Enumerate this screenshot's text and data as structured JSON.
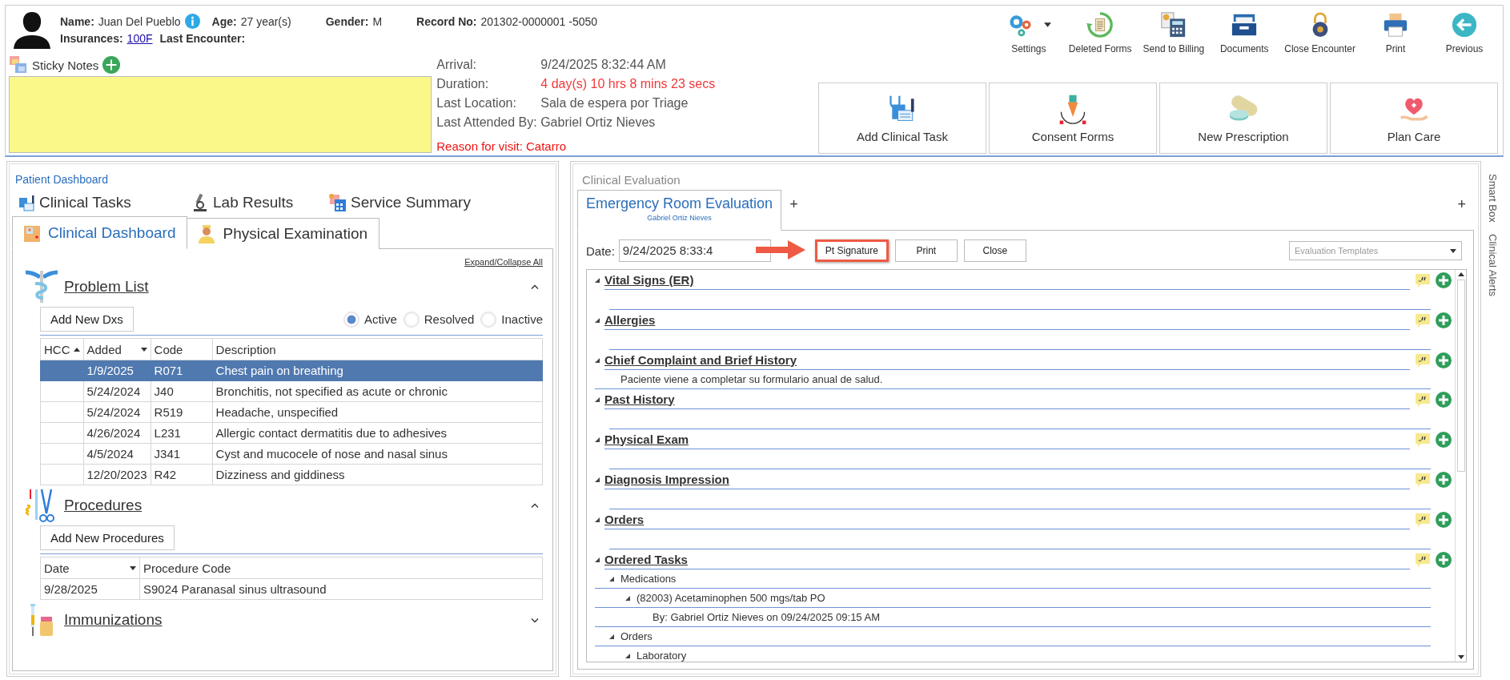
{
  "patient": {
    "name_label": "Name:",
    "name": "Juan Del Pueblo",
    "age_label": "Age:",
    "age": "27 year(s)",
    "gender_label": "Gender:",
    "gender": "M",
    "record_label": "Record No:",
    "record": "201302-0000001 -5050",
    "insurances_label": "Insurances:",
    "insurance": "100F",
    "last_encounter_label": "Last Encounter:"
  },
  "toolbar": [
    {
      "label": "Settings",
      "kind": "settings"
    },
    {
      "label": "Deleted Forms",
      "kind": "deleted"
    },
    {
      "label": "Send to Billing",
      "kind": "billing"
    },
    {
      "label": "Documents",
      "kind": "documents"
    },
    {
      "label": "Close Encounter",
      "kind": "lock"
    },
    {
      "label": "Print",
      "kind": "print"
    },
    {
      "label": "Previous",
      "kind": "previous"
    }
  ],
  "sticky_notes": {
    "label": "Sticky Notes"
  },
  "encounter": {
    "rows": [
      {
        "label": "Arrival:",
        "value": "9/24/2025 8:32:44 AM",
        "alert": false
      },
      {
        "label": "Duration:",
        "value": "4 day(s) 10 hrs 8 mins 23 secs",
        "alert": true
      },
      {
        "label": "Last Location:",
        "value": "Sala de espera por Triage",
        "alert": false
      }
    ],
    "attended": "Last Attended By: Gabriel Ortiz Nieves",
    "reason": "Reason for visit: Catarro"
  },
  "actions": [
    {
      "label": "Add Clinical Task",
      "kind": "task"
    },
    {
      "label": "Consent Forms",
      "kind": "consent"
    },
    {
      "label": "New Prescription",
      "kind": "prescription"
    },
    {
      "label": "Plan Care",
      "kind": "care"
    }
  ],
  "dashboard": {
    "title": "Patient Dashboard",
    "tabs": [
      {
        "label": "Clinical Tasks",
        "kind": "tasks",
        "selected": false
      },
      {
        "label": "Lab Results",
        "kind": "lab",
        "selected": false
      },
      {
        "label": "Service Summary",
        "kind": "summary",
        "selected": false
      },
      {
        "label": "Clinical Dashboard",
        "kind": "dashboard",
        "selected": true
      },
      {
        "label": "Physical Examination",
        "kind": "exam",
        "selected": false
      }
    ],
    "expand_all": "Expand/Collapse All",
    "problem_list": {
      "title": "Problem List",
      "expanded": true,
      "add_button": "Add New Dxs",
      "filters": [
        {
          "label": "Active",
          "selected": true
        },
        {
          "label": "Resolved",
          "selected": false
        },
        {
          "label": "Inactive",
          "selected": false
        }
      ],
      "columns": [
        "HCC",
        "Added",
        "Code",
        "Description"
      ],
      "rows": [
        {
          "hcc": "",
          "added": "1/9/2025",
          "code": "R071",
          "description": "Chest pain on breathing",
          "selected": true
        },
        {
          "hcc": "",
          "added": "5/24/2024",
          "code": "J40",
          "description": "Bronchitis, not specified as acute or chronic",
          "selected": false
        },
        {
          "hcc": "",
          "added": "5/24/2024",
          "code": "R519",
          "description": "Headache, unspecified",
          "selected": false
        },
        {
          "hcc": "",
          "added": "4/26/2024",
          "code": "L231",
          "description": "Allergic contact dermatitis due to adhesives",
          "selected": false
        },
        {
          "hcc": "",
          "added": "4/5/2024",
          "code": "J341",
          "description": "Cyst and mucocele of nose and nasal sinus",
          "selected": false
        },
        {
          "hcc": "",
          "added": "12/20/2023",
          "code": "R42",
          "description": "Dizziness and giddiness",
          "selected": false
        }
      ]
    },
    "procedures": {
      "title": "Procedures",
      "expanded": true,
      "add_button": "Add New Procedures",
      "columns": [
        "Date",
        "Procedure Code"
      ],
      "rows": [
        {
          "date": "9/28/2025",
          "procedure": "S9024 Paranasal sinus ultrasound"
        }
      ]
    },
    "immunizations": {
      "title": "Immunizations",
      "expanded": false
    }
  },
  "evaluation": {
    "title": "Clinical Evaluation",
    "tabs": [
      {
        "label": "Emergency Room Evaluation",
        "subtitle": "Gabriel Ortiz Nieves",
        "selected": true
      }
    ],
    "add_tab": "+",
    "add_right": "+",
    "date_label": "Date:",
    "date_value": "9/24/2025 8:33:4",
    "buttons": [
      {
        "label": "Pt Signature",
        "highlighted": true
      },
      {
        "label": "Print",
        "highlighted": false
      },
      {
        "label": "Close",
        "highlighted": false
      }
    ],
    "templates": {
      "placeholder": "Evaluation Templates"
    },
    "sections": [
      {
        "title": "Vital Signs (ER)",
        "expanded": true
      },
      {
        "title": "Allergies",
        "expanded": true
      },
      {
        "title": "Chief Complaint and Brief History",
        "expanded": true,
        "children": [
          {
            "text": "Paciente viene a completar su formulario anual de salud."
          }
        ]
      },
      {
        "title": "Past History",
        "expanded": true
      },
      {
        "title": "Physical Exam",
        "expanded": true
      },
      {
        "title": "Diagnosis Impression",
        "expanded": true
      },
      {
        "title": "Orders",
        "expanded": true
      },
      {
        "title": "Ordered Tasks",
        "expanded": true,
        "children": [
          {
            "text": "Medications",
            "expanded": true,
            "children": [
              {
                "text": "(82003) Acetaminophen 500 mgs/tab PO",
                "expanded": true,
                "children": [
                  {
                    "text": "By: Gabriel Ortiz Nieves on 09/24/2025 09:15 AM"
                  }
                ]
              }
            ]
          },
          {
            "text": "Orders",
            "expanded": true,
            "children": [
              {
                "text": "Laboratory",
                "expanded": true
              }
            ]
          }
        ]
      }
    ]
  },
  "side_tabs": [
    "Smart Box",
    "Clinical Alerts"
  ]
}
